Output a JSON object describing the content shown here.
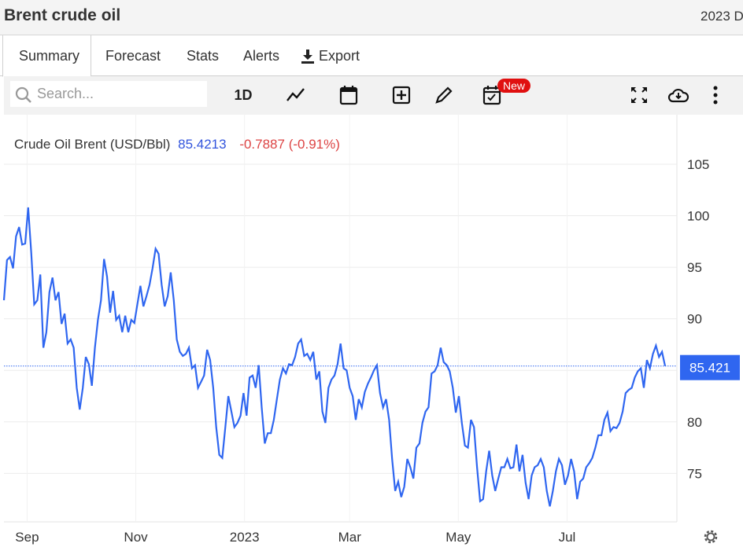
{
  "header": {
    "title": "Brent crude oil",
    "year_text": "2023 D"
  },
  "tabs": [
    {
      "label": "Summary"
    },
    {
      "label": "Forecast"
    },
    {
      "label": "Stats"
    },
    {
      "label": "Alerts"
    },
    {
      "label": "Export"
    }
  ],
  "toolbar": {
    "search_placeholder": "Search...",
    "interval": "1D",
    "new_badge": "New",
    "icons": [
      "search-icon",
      "line-chart-icon",
      "calendar-icon",
      "add-indicator-icon",
      "pencil-icon",
      "calendar-check-icon",
      "fullscreen-icon",
      "cloud-download-icon",
      "more-vertical-icon",
      "settings-gear-icon"
    ]
  },
  "legend": {
    "name": "Crude Oil Brent (USD/Bbl)",
    "value": "85.4213",
    "change": "-0.7887 (-0.91%)"
  },
  "colors": {
    "line": "#2f66f0",
    "value": "#3355dd",
    "negative": "#dd4444",
    "price_tag": "#2f66f0"
  },
  "chart_data": {
    "type": "line",
    "title": "Crude Oil Brent (USD/Bbl)",
    "xlabel": "",
    "ylabel": "",
    "x_start": "2022-08-19",
    "x_end": "2023-08-25",
    "xticks": [
      {
        "label": "Sep",
        "date": "2022-09-01"
      },
      {
        "label": "Nov",
        "date": "2022-11-01"
      },
      {
        "label": "2023",
        "date": "2023-01-01"
      },
      {
        "label": "Mar",
        "date": "2023-03-01"
      },
      {
        "label": "May",
        "date": "2023-05-01"
      },
      {
        "label": "Jul",
        "date": "2023-07-01"
      }
    ],
    "yticks": [
      75,
      80,
      85,
      90,
      95,
      100,
      105
    ],
    "ylim": [
      70.3,
      109.8
    ],
    "grid": true,
    "last_price_label": "85.421",
    "last_price": 85.4213,
    "series": [
      {
        "name": "Crude Oil Brent",
        "values": [
          91.8,
          95.7,
          96.0,
          94.9,
          98.0,
          98.9,
          97.2,
          97.3,
          100.8,
          96.4,
          91.4,
          91.8,
          94.3,
          87.2,
          88.7,
          92.6,
          94.0,
          91.8,
          92.6,
          89.5,
          90.5,
          87.6,
          88.0,
          87.2,
          83.3,
          81.2,
          83.3,
          86.3,
          85.6,
          83.5,
          87.2,
          89.9,
          91.8,
          95.8,
          94.1,
          90.6,
          92.7,
          89.9,
          90.3,
          88.7,
          90.3,
          88.7,
          89.9,
          89.6,
          91.4,
          93.2,
          91.2,
          92.2,
          93.3,
          94.9,
          96.8,
          96.3,
          93.3,
          91.2,
          92.2,
          94.5,
          91.8,
          88.0,
          86.8,
          86.4,
          86.6,
          87.2,
          85.2,
          85.5,
          83.3,
          83.9,
          84.5,
          87.0,
          86.0,
          83.3,
          79.5,
          76.8,
          76.5,
          79.5,
          82.5,
          81.0,
          79.5,
          79.9,
          80.6,
          82.8,
          80.6,
          84.3,
          84.5,
          83.3,
          85.5,
          81.4,
          77.9,
          78.9,
          78.9,
          80.2,
          82.2,
          84.1,
          85.2,
          84.7,
          85.6,
          85.5,
          86.3,
          87.6,
          88.0,
          86.4,
          86.6,
          86.0,
          86.8,
          84.1,
          84.9,
          81.0,
          79.9,
          83.3,
          84.1,
          84.5,
          85.6,
          87.6,
          85.2,
          85.0,
          83.3,
          82.5,
          80.2,
          82.2,
          81.4,
          82.9,
          83.7,
          84.3,
          85.0,
          85.5,
          82.8,
          81.4,
          82.2,
          80.2,
          76.4,
          73.3,
          74.2,
          72.7,
          73.7,
          76.4,
          75.6,
          74.5,
          77.5,
          77.9,
          79.9,
          81.0,
          81.4,
          84.7,
          84.9,
          85.5,
          87.2,
          85.8,
          85.5,
          84.9,
          83.3,
          80.9,
          82.5,
          79.9,
          77.7,
          77.5,
          80.2,
          79.5,
          75.6,
          72.3,
          72.5,
          75.2,
          77.2,
          74.8,
          73.3,
          74.5,
          75.6,
          75.6,
          76.4,
          75.5,
          75.6,
          77.8,
          75.2,
          76.8,
          74.1,
          72.5,
          74.8,
          75.6,
          75.8,
          76.4,
          75.6,
          73.3,
          71.8,
          73.3,
          75.2,
          76.4,
          75.8,
          73.9,
          74.8,
          76.4,
          75.2,
          72.5,
          74.2,
          74.5,
          75.6,
          76.0,
          76.5,
          77.5,
          78.7,
          78.7,
          80.2,
          80.9,
          79.1,
          79.5,
          79.4,
          79.9,
          81.0,
          82.8,
          83.1,
          83.3,
          84.3,
          84.9,
          85.2,
          83.3,
          86.0,
          85.2,
          86.6,
          87.4,
          86.3,
          86.8,
          85.42
        ]
      }
    ]
  }
}
